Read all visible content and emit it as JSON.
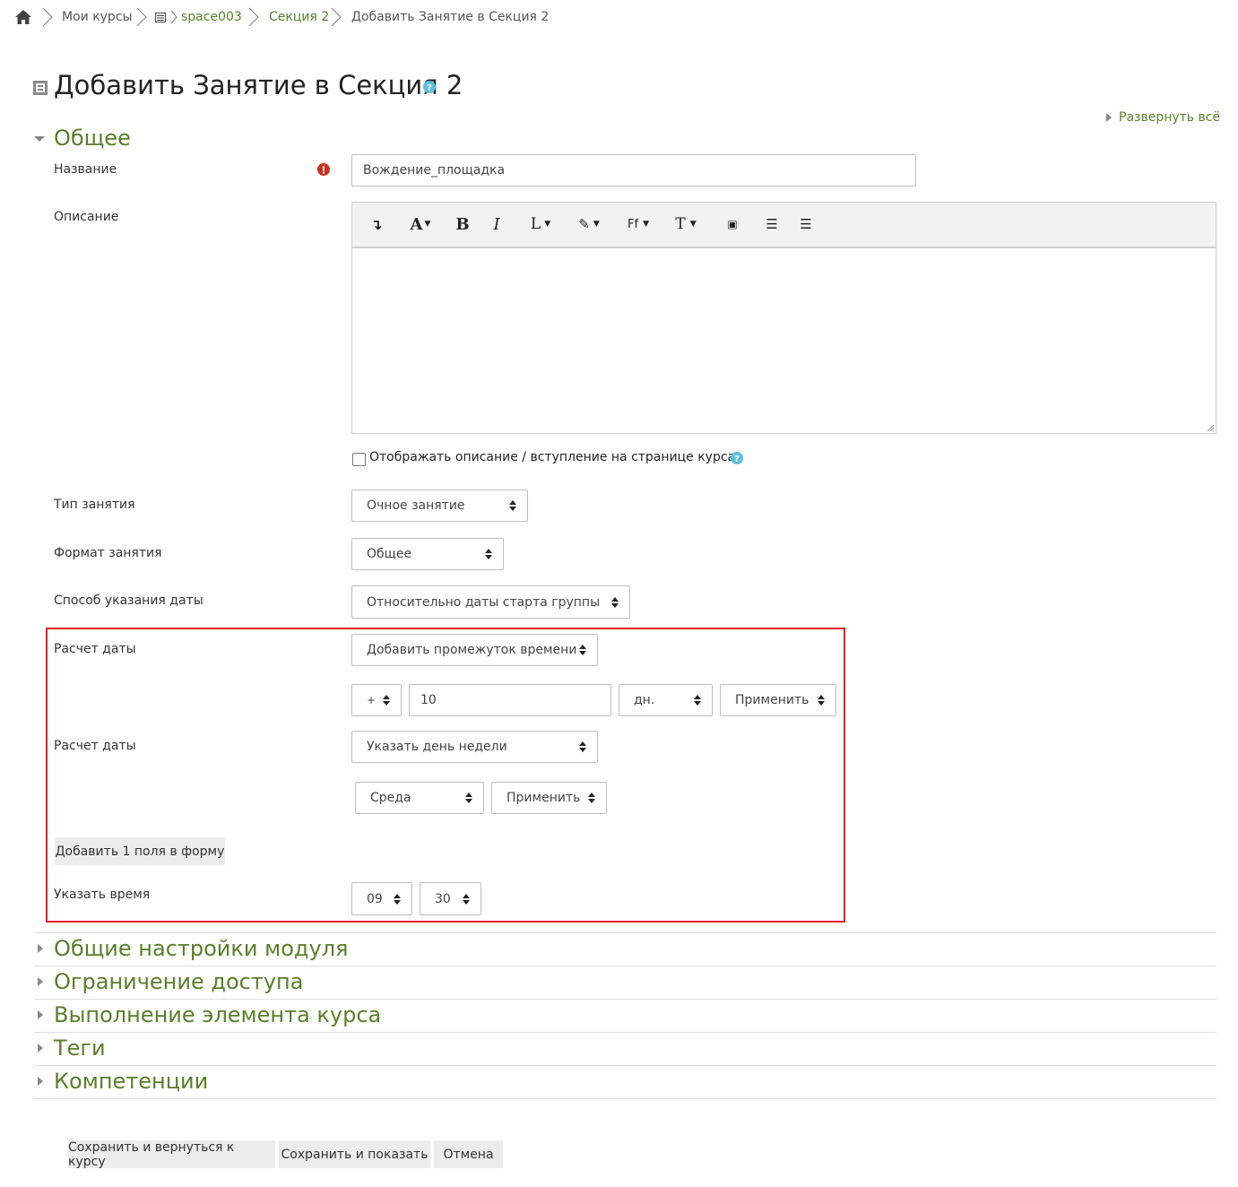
{
  "breadcrumb": {
    "home_icon": "home-icon",
    "items": [
      "Мои курсы",
      "space003",
      "Секция 2",
      "Добавить Занятие в Секция 2"
    ]
  },
  "page": {
    "title": "Добавить Занятие в Секция 2",
    "expand_all": "Развернуть всё"
  },
  "section_general": {
    "title": "Общее"
  },
  "form": {
    "name_label": "Название",
    "name_value": "Вождение_площадка",
    "description_label": "Описание",
    "toolbar": [
      "paragraph-icon",
      "font-color-icon",
      "bold-icon",
      "italic-icon",
      "link-icon",
      "brush-icon",
      "font-family-icon",
      "font-size-icon",
      "media-icon",
      "bullet-list-icon",
      "numbered-list-icon"
    ],
    "show_description_label": "Отображать описание / вступление на странице курса",
    "lesson_type_label": "Тип занятия",
    "lesson_type_value": "Очное занятие",
    "lesson_format_label": "Формат занятия",
    "lesson_format_value": "Общее",
    "date_method_label": "Способ указания даты",
    "date_method_value": "Относительно даты старта группы",
    "date_calc1_label": "Расчет даты",
    "date_calc1_value": "Добавить промежуток времени",
    "sign_value": "+",
    "amount_value": "10",
    "unit_value": "дн.",
    "apply1_value": "Применить",
    "date_calc2_label": "Расчет даты",
    "date_calc2_value": "Указать день недели",
    "weekday_value": "Среда",
    "apply2_value": "Применить",
    "add_field_button": "Добавить 1 поля в форму",
    "time_label": "Указать время",
    "hour_value": "09",
    "minute_value": "30"
  },
  "sections": [
    "Общие настройки модуля",
    "Ограничение доступа",
    "Выполнение элемента курса",
    "Теги",
    "Компетенции"
  ],
  "buttons": {
    "save_return": "Сохранить и вернуться к курсу",
    "save_show": "Сохранить и показать",
    "cancel": "Отмена"
  },
  "colors": {
    "accent_green": "#5a7f2a",
    "required_red": "#ca3120",
    "help_blue": "#5bc0de",
    "highlight_red": "#e0202a"
  }
}
